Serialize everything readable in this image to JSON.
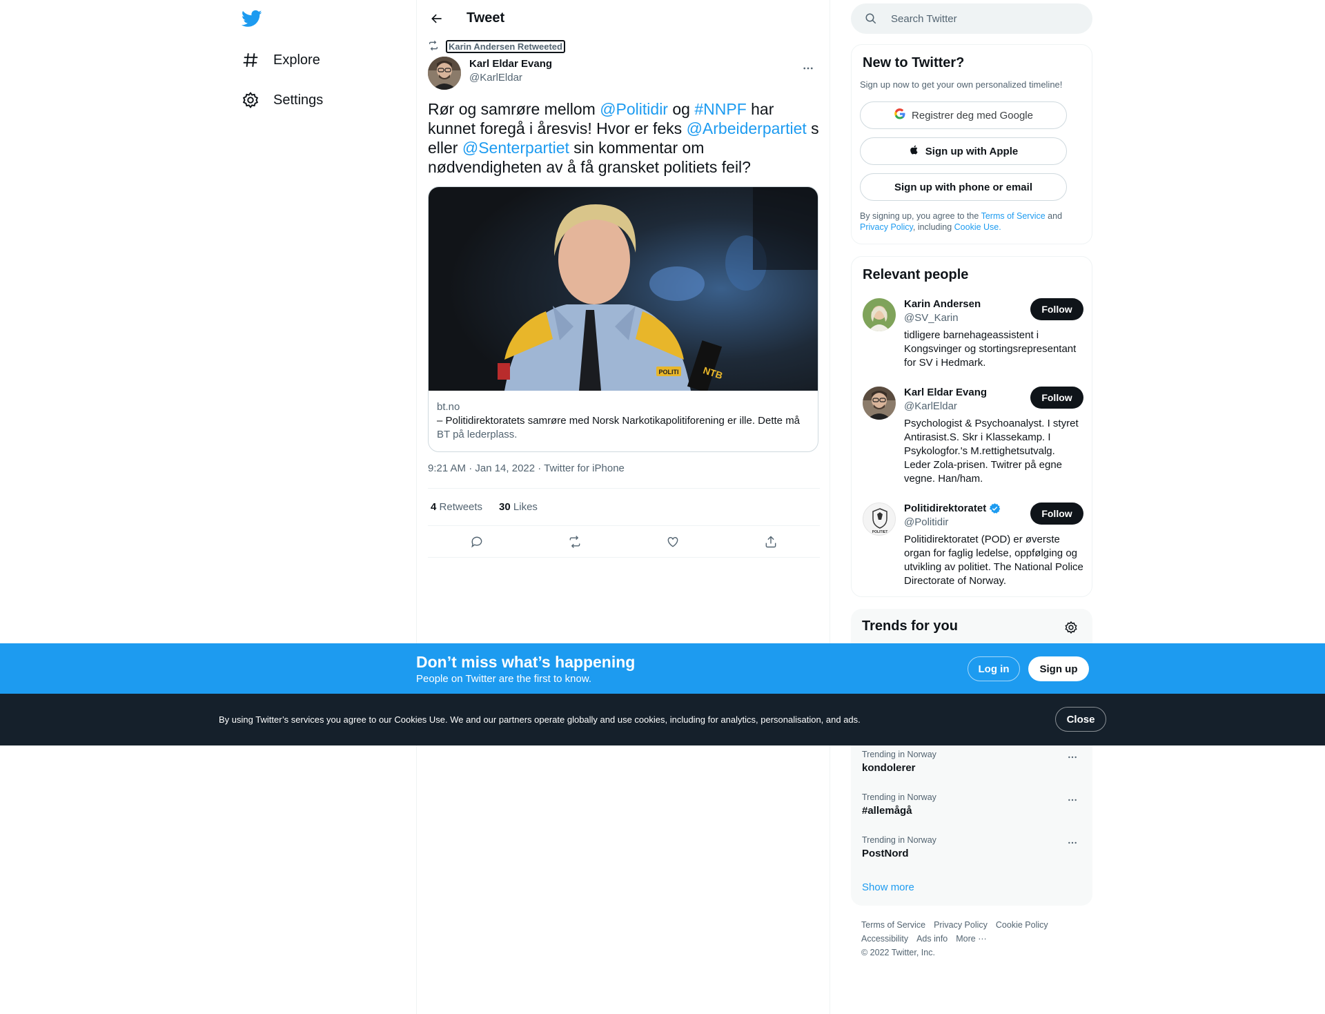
{
  "nav": {
    "logo": "twitter-bird-icon",
    "items": [
      {
        "label": "Explore",
        "icon": "hashtag-icon"
      },
      {
        "label": "Settings",
        "icon": "gear-icon"
      }
    ]
  },
  "header": {
    "title": "Tweet"
  },
  "tweet": {
    "retweeted_by": "Karin Andersen Retweeted",
    "author_name": "Karl Eldar Evang",
    "author_handle": "@KarlEldar",
    "text_parts": {
      "p1": "Rør og samrøre mellom ",
      "m1": "@Politidir",
      "p2": " og ",
      "m2": "#NNPF",
      "p3": " har kunnet foregå i åresvis! Hvor er feks ",
      "m3": "@Arbeiderpartiet",
      "p4": " s eller ",
      "m4": "@Senterpartiet",
      "p5": " sin kommentar om nødvendigheten av å få gransket politiets feil?"
    },
    "card": {
      "domain": "bt.no",
      "title": "– Politidirektoratets samrøre med Norsk Narkotikapolitiforening er ille. Dette må",
      "description": "BT på lederplass.",
      "image_badges": {
        "politi": "POLITI",
        "ntb": "NTB"
      }
    },
    "timestamp": "9:21 AM · Jan 14, 2022 · Twitter for iPhone",
    "retweets_count": "4",
    "retweets_label": "Retweets",
    "likes_count": "30",
    "likes_label": "Likes"
  },
  "sidebar": {
    "search_placeholder": "Search Twitter",
    "new_to_twitter": {
      "title": "New to Twitter?",
      "subtitle": "Sign up now to get your own personalized timeline!",
      "google_btn": "Registrer deg med Google",
      "apple_btn": "Sign up with Apple",
      "phone_btn": "Sign up with phone or email",
      "legal_1": "By signing up, you agree to the ",
      "legal_tos": "Terms of Service",
      "legal_2": " and ",
      "legal_pp": "Privacy Policy",
      "legal_3": ", including ",
      "legal_cu": "Cookie Use."
    },
    "relevant_people": {
      "title": "Relevant people",
      "follow_label": "Follow",
      "people": [
        {
          "name": "Karin Andersen",
          "handle": "@SV_Karin",
          "bio": "tidligere barnehageassistent i Kongsvinger og stortingsrepresentant for SV i Hedmark."
        },
        {
          "name": "Karl Eldar Evang",
          "handle": "@KarlEldar",
          "bio": "Psychologist & Psychoanalyst. I styret Antirasist.S. Skr i Klassekamp. I Psykologfor.'s M.rettighetsutvalg. Leder Zola-prisen. Twitrer på egne vegne. Han/ham."
        },
        {
          "name": "Politidirektoratet",
          "handle": "@Politidir",
          "bio": "Politidirektoratet (POD) er øverste organ for faglig ledelse, oppfølging og utvikling av politiet. The National Police Directorate of Norway.",
          "verified": true,
          "avatar_text": "POLITIET"
        }
      ]
    },
    "trends": {
      "title": "Trends for you",
      "items": [
        {
          "context": "Trending in Norway",
          "name": "kondolerer"
        },
        {
          "context": "Trending in Norway",
          "name": "#allemågå"
        },
        {
          "context": "Trending in Norway",
          "name": "PostNord"
        }
      ],
      "show_more": "Show more"
    },
    "footer": {
      "links": [
        "Terms of Service",
        "Privacy Policy",
        "Cookie Policy",
        "Accessibility",
        "Ads info",
        "More ···"
      ],
      "copyright": "© 2022 Twitter, Inc."
    }
  },
  "banner": {
    "title": "Don’t miss what’s happening",
    "subtitle": "People on Twitter are the first to know.",
    "login": "Log in",
    "signup": "Sign up"
  },
  "cookie": {
    "text": "By using Twitter’s services you agree to our Cookies Use. We and our partners operate globally and use cookies, including for analytics, personalisation, and ads.",
    "close": "Close"
  },
  "colors": {
    "accent": "#1d9bf0",
    "text": "#0f1419",
    "muted": "#536471",
    "cookie_bg": "#15202b"
  }
}
